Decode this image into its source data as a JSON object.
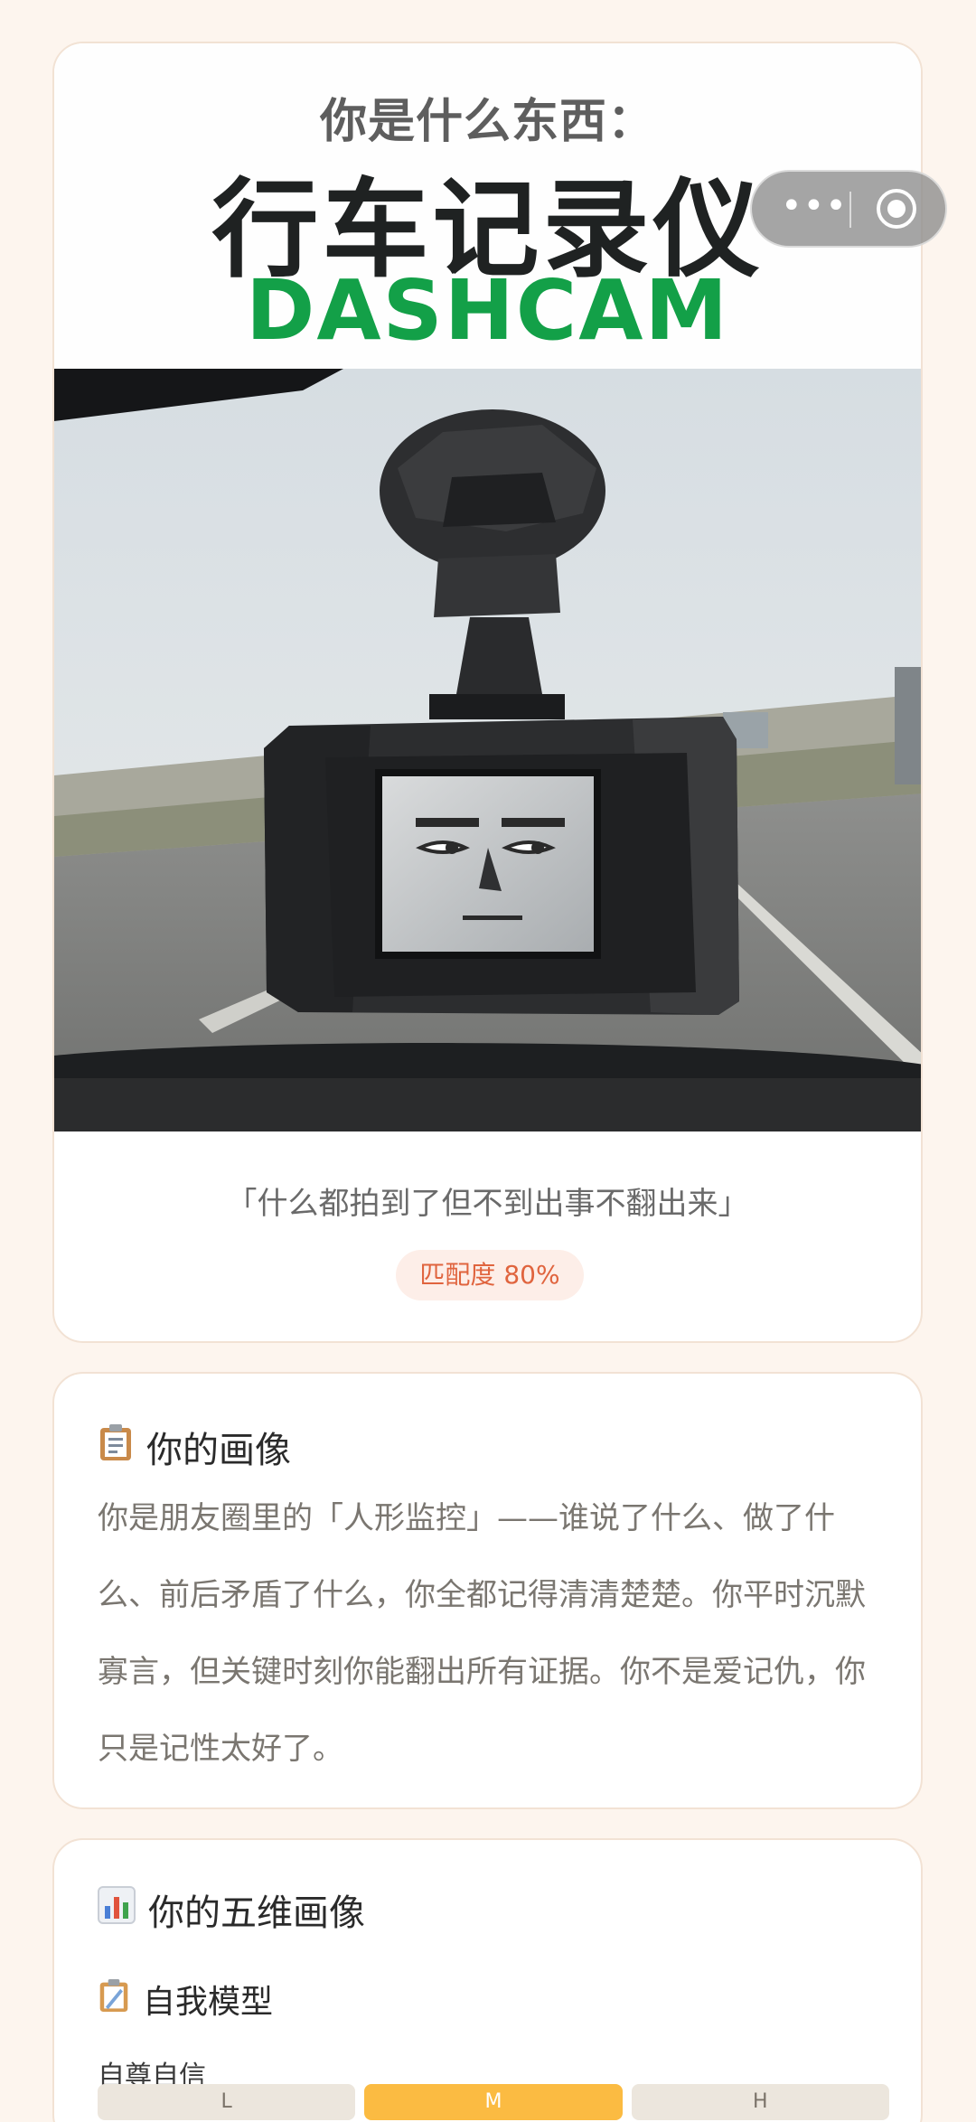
{
  "result": {
    "subtitle": "你是什么东西：",
    "title_cn": "行车记录仪",
    "title_en": "DASHCAM",
    "quote": "「什么都拍到了但不到出事不翻出来」",
    "match": "匹配度 80%"
  },
  "capsule": {
    "more_icon": "more-dots-icon",
    "close_icon": "target-close-icon"
  },
  "profile": {
    "icon": "clipboard-icon",
    "title": "你的画像",
    "text": "你是朋友圈里的「人形监控」——谁说了什么、做了什么、前后矛盾了什么，你全都记得清清楚楚。你平时沉默寡言，但关键时刻你能翻出所有证据。你不是爱记仇，你只是记性太好了。"
  },
  "dimensions": {
    "icon": "bar-chart-icon",
    "title": "你的五维画像",
    "model": {
      "icon": "clipboard-icon",
      "title": "自我模型"
    },
    "items": [
      {
        "label": "自尊自信",
        "scale": [
          "L",
          "M",
          "H"
        ],
        "selected": "M"
      }
    ]
  },
  "colors": {
    "accent_green": "#13a048",
    "match_text": "#e0643e",
    "scale_active": "#fbbb42",
    "background": "#fdf5ee"
  }
}
